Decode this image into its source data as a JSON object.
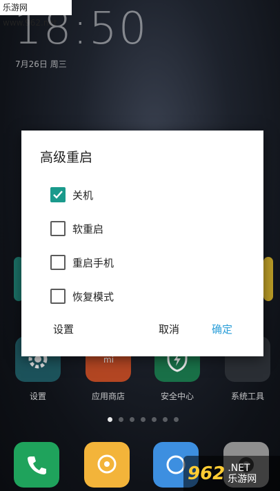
{
  "watermark_top": "乐游网 www.962.net",
  "clock": {
    "time": "18:50",
    "date": "7月26日 周三"
  },
  "apps": [
    {
      "label": "设置",
      "icon": "gear-icon"
    },
    {
      "label": "应用商店",
      "icon": "store-icon"
    },
    {
      "label": "安全中心",
      "icon": "shield-icon"
    },
    {
      "label": "系统工具",
      "icon": "folder-icon"
    }
  ],
  "page_indicator": {
    "count": 7,
    "active": 0
  },
  "dock": [
    {
      "icon": "phone-icon"
    },
    {
      "icon": "message-icon"
    },
    {
      "icon": "browser-icon"
    },
    {
      "icon": "camera-icon"
    }
  ],
  "watermark_bottom": {
    "big": "962",
    "small": ".NET",
    "sub": "乐游网"
  },
  "dialog": {
    "title": "高级重启",
    "options": [
      {
        "label": "关机",
        "checked": true
      },
      {
        "label": "软重启",
        "checked": false
      },
      {
        "label": "重启手机",
        "checked": false
      },
      {
        "label": "恢复模式",
        "checked": false
      }
    ],
    "buttons": {
      "settings": "设置",
      "cancel": "取消",
      "confirm": "确定"
    },
    "accent_color": "#1a9a8c",
    "confirm_color": "#2a9ed8"
  }
}
